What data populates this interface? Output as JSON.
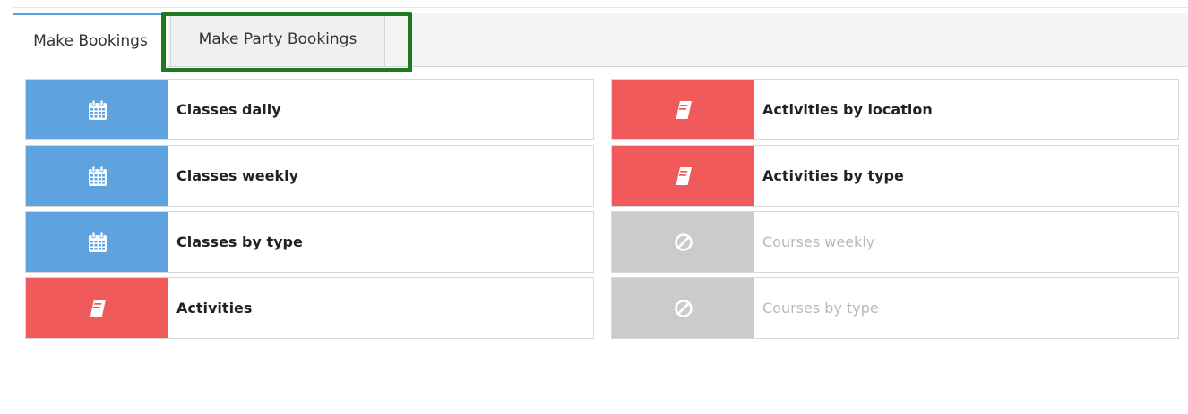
{
  "tabs": {
    "make_bookings": "Make Bookings",
    "make_party_bookings": "Make Party Bookings"
  },
  "colors": {
    "classes": "#5ea3dd",
    "activities": "#f15a5a",
    "disabled": "#cbcbcb",
    "highlight": "#1e7a1e"
  },
  "left_column": [
    {
      "label": "Classes daily",
      "icon": "calendar-icon",
      "enabled": true
    },
    {
      "label": "Classes weekly",
      "icon": "calendar-icon",
      "enabled": true
    },
    {
      "label": "Classes by type",
      "icon": "calendar-icon",
      "enabled": true
    },
    {
      "label": "Activities",
      "icon": "book-icon",
      "enabled": true
    }
  ],
  "right_column": [
    {
      "label": "Activities by location",
      "icon": "book-icon",
      "enabled": true
    },
    {
      "label": "Activities by type",
      "icon": "book-icon",
      "enabled": true
    },
    {
      "label": "Courses weekly",
      "icon": "ban-icon",
      "enabled": false
    },
    {
      "label": "Courses by type",
      "icon": "ban-icon",
      "enabled": false
    }
  ]
}
